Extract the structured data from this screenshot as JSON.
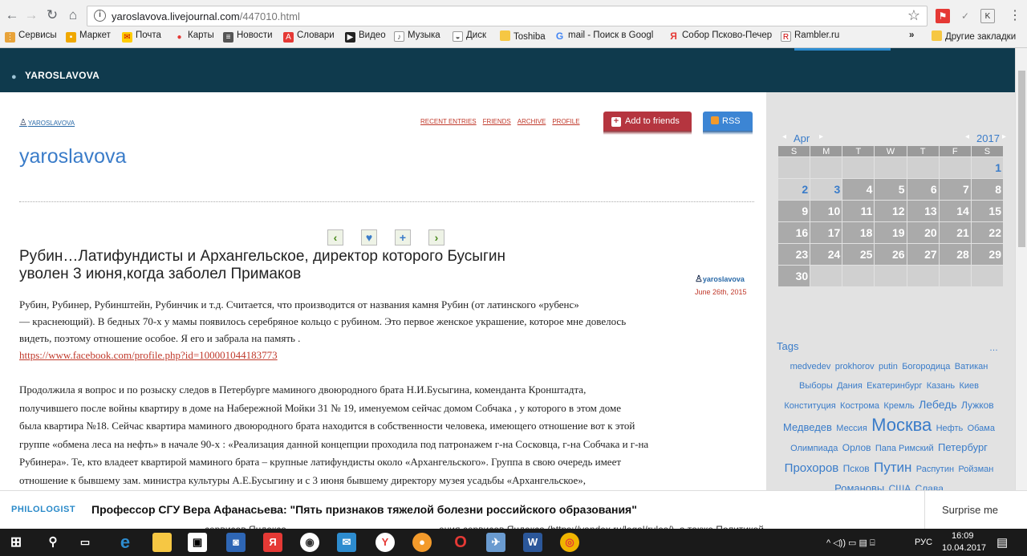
{
  "browser": {
    "url_host": "yaroslavova.livejournal.com",
    "url_path": "/447010.html",
    "bookmarks": [
      "Сервисы",
      "Маркет",
      "Почта",
      "Карты",
      "Новости",
      "Словари",
      "Видео",
      "Музыка",
      "Диск",
      "Toshiba",
      "mail - Поиск в Googl",
      "Собор Псково-Печер",
      "Rambler.ru"
    ],
    "overflow": "»",
    "other_bookmarks": "Другие закладки"
  },
  "lj": {
    "username": "YAROSLAVOVA",
    "small_user": "YAROSLAVOVA",
    "nav": [
      "RECENT ENTRIES",
      "FRIENDS",
      "ARCHIVE",
      "PROFILE"
    ],
    "add_friends": "Add to friends",
    "rss": "RSS",
    "journal_title": "yaroslavova"
  },
  "post": {
    "title_line1": "Рубин…Латифундисты и Архангельское, директор которого Бусыгин",
    "title_line2": "уволен 3 июня,когда заболел Примаков",
    "author": "yaroslavova",
    "date": "June 26th, 2015",
    "para1": [
      "Рубин, Рубинер, Рубинштейн, Рубинчик и т.д.  Считается, что  производится от названия камня  Рубин (от латинского «рубенс»",
      "— краснеющий).  В бедных  70-х у мамы   появилось  серебряное кольцо  с рубином. Это первое  женское украшение, которое мне довелось",
      "видеть,  поэтому отношение особое.  Я  его  и забрала на память ."
    ],
    "link": "https://www.facebook.com/profile.php?id=100001044183773",
    "para2": [
      "Продолжила я  вопрос и по розыску следов в Петербурге   маминого двоюродного брата Н.И.Бусыгина, коменданта Кронштадта,",
      "получившего  после войны квартиру  в доме  на Набережной Мойки 31  № 19, именуемом сейчас домом  Собчака ,  у которого в этом  доме",
      "была  квартира №18. Сейчас квартира  маминого двоюродного брата     находится в собственности человека,  имеющего отношение вот к этой",
      "группе  «обмена леса на нефть» в начале 90-х :  «Реализация данной концепции проходила под патронажем г-на Сосковца, г-на Собчака и г-на",
      "Рубинера». Те, кто владеет квартирой  маминого брата – крупные    латифундисты  около  «Архангельского». Группа в свою   очередь имеет",
      "отношение к    бывшему зам. министра   культуры  А.Е.Бусыгину и      с 3 июня бывшему  директору    музея  усадьбы «Архангельское»,"
    ]
  },
  "calendar": {
    "month": "Apr",
    "year": "2017",
    "days": [
      "S",
      "M",
      "T",
      "W",
      "T",
      "F",
      "S"
    ],
    "weeks": [
      [
        "",
        "",
        "",
        "",
        "",
        "",
        "1"
      ],
      [
        "2",
        "3",
        "4",
        "5",
        "6",
        "7",
        "8"
      ],
      [
        "9",
        "10",
        "11",
        "12",
        "13",
        "14",
        "15"
      ],
      [
        "16",
        "17",
        "18",
        "19",
        "20",
        "21",
        "22"
      ],
      [
        "23",
        "24",
        "25",
        "26",
        "27",
        "28",
        "29"
      ],
      [
        "30",
        "",
        "",
        "",
        "",
        "",
        ""
      ]
    ]
  },
  "tags": {
    "heading": "Tags",
    "more": "…",
    "items": [
      {
        "t": "medvedev",
        "s": 11
      },
      {
        "t": "prokhorov",
        "s": 11
      },
      {
        "t": "putin",
        "s": 11
      },
      {
        "t": "Богородица",
        "s": 11
      },
      {
        "t": "Ватикан",
        "s": 11
      },
      {
        "t": "Выборы",
        "s": 11
      },
      {
        "t": "Дания",
        "s": 11
      },
      {
        "t": "Екатеринбург",
        "s": 11
      },
      {
        "t": "Казань",
        "s": 11
      },
      {
        "t": "Киев",
        "s": 11
      },
      {
        "t": "Конституция",
        "s": 11
      },
      {
        "t": "Кострома",
        "s": 11
      },
      {
        "t": "Кремль",
        "s": 11
      },
      {
        "t": "Лебедь",
        "s": 14
      },
      {
        "t": "Лужков",
        "s": 12
      },
      {
        "t": "Медведев",
        "s": 13
      },
      {
        "t": "Мессия",
        "s": 11
      },
      {
        "t": "Москва",
        "s": 22
      },
      {
        "t": "Нефть",
        "s": 11
      },
      {
        "t": "Обама",
        "s": 11
      },
      {
        "t": "Олимпиада",
        "s": 11
      },
      {
        "t": "Орлов",
        "s": 12
      },
      {
        "t": "Папа Римский",
        "s": 11
      },
      {
        "t": "Петербург",
        "s": 13
      },
      {
        "t": "Прохоров",
        "s": 15
      },
      {
        "t": "Псков",
        "s": 12
      },
      {
        "t": "Путин",
        "s": 17
      },
      {
        "t": "Распутин",
        "s": 11
      },
      {
        "t": "Ройзман",
        "s": 11
      },
      {
        "t": "Романовы",
        "s": 13
      },
      {
        "t": "США",
        "s": 12
      },
      {
        "t": "Слава",
        "s": 12
      }
    ]
  },
  "banner": {
    "label": "PHILOLOGIST",
    "headline": "Профессор СГУ Вера Афанасьева: \"Пять признаков тяжелой болезни российского образования\"",
    "surprise": "Surprise me",
    "ghost_left": "сервисов Яндекса",
    "ghost_right": "ения сервисов Яндекса (https://yandex.ru/legal/rules/), а также Политикой"
  },
  "taskbar": {
    "lang": "РУС",
    "time": "16:09",
    "date": "10.04.2017"
  },
  "colors": {
    "lj_header": "#0f3a4d",
    "accent": "#3a7cc9",
    "link_red": "#c0392b",
    "sidebar": "#e2e2e2"
  }
}
